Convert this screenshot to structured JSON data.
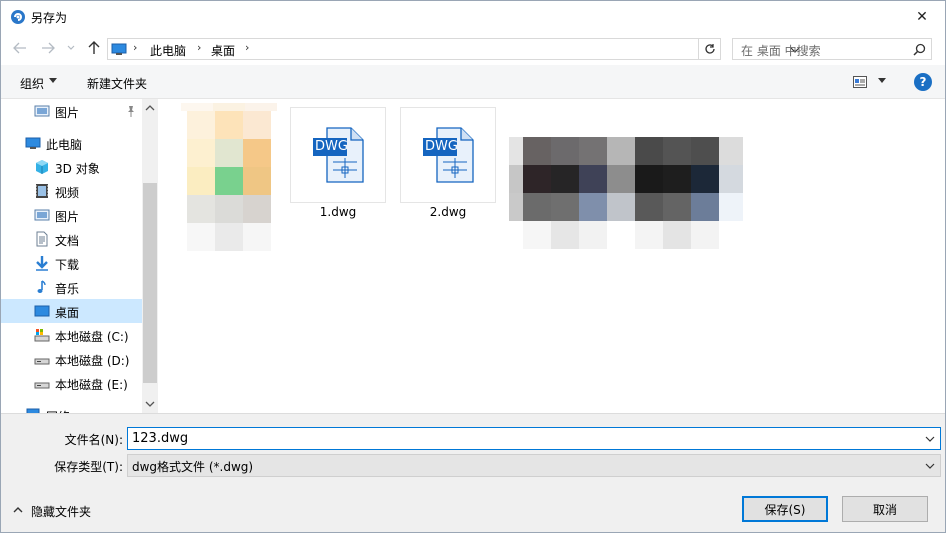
{
  "window": {
    "title": "另存为",
    "close_symbol": "✕"
  },
  "address": {
    "crumbs": [
      "此电脑",
      "桌面"
    ],
    "search_placeholder": "在 桌面 中搜索"
  },
  "toolbar": {
    "organize_label": "组织",
    "new_folder_label": "新建文件夹",
    "help_label": "?"
  },
  "nav_pane": {
    "items": [
      {
        "label": "图片",
        "icon": "pictures-icon",
        "pinned": true
      },
      {
        "label": "此电脑",
        "icon": "this-pc-icon"
      },
      {
        "label": "3D 对象",
        "icon": "3d-objects-icon"
      },
      {
        "label": "视频",
        "icon": "videos-icon"
      },
      {
        "label": "图片",
        "icon": "pictures-icon"
      },
      {
        "label": "文档",
        "icon": "documents-icon"
      },
      {
        "label": "下载",
        "icon": "downloads-icon"
      },
      {
        "label": "音乐",
        "icon": "music-icon"
      },
      {
        "label": "桌面",
        "icon": "desktop-icon",
        "selected": true
      },
      {
        "label": "本地磁盘 (C:)",
        "icon": "drive-c-icon"
      },
      {
        "label": "本地磁盘 (D:)",
        "icon": "drive-icon"
      },
      {
        "label": "本地磁盘 (E:)",
        "icon": "drive-icon"
      },
      {
        "label": "网络",
        "icon": "network-icon"
      }
    ]
  },
  "files": [
    {
      "name": "1.dwg",
      "icon_text": "DWG"
    },
    {
      "name": "2.dwg",
      "icon_text": "DWG"
    }
  ],
  "save_form": {
    "filename_label": "文件名(N):",
    "filename_value": "123.dwg",
    "filetype_label": "保存类型(T):",
    "filetype_value": "dwg格式文件 (*.dwg)",
    "hide_folders_label": "隐藏文件夹",
    "save_label": "保存(S)",
    "cancel_label": "取消"
  },
  "colors": {
    "accent": "#0078d7",
    "selection": "#cce8ff",
    "dwg_blue": "#1565c0"
  }
}
